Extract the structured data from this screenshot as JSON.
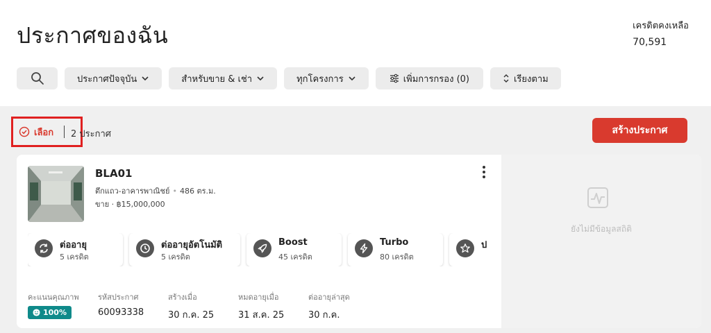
{
  "header": {
    "title": "ประกาศของฉัน",
    "credit_label": "เครดิตคงเหลือ",
    "credit_value": "70,591"
  },
  "filters": [
    {
      "label": "ประกาศปัจจุบัน",
      "icon": "chevron-down-icon"
    },
    {
      "label": "สำหรับขาย & เช่า",
      "icon": "chevron-down-icon"
    },
    {
      "label": "ทุกโครงการ",
      "icon": "chevron-down-icon"
    },
    {
      "label": "เพิ่มการกรอง (0)",
      "icon": "filter-sliders-icon"
    },
    {
      "label": "เรียงตาม",
      "icon": "sort-icon"
    }
  ],
  "toolbar": {
    "select_label": "เลือก",
    "count_text": "2 ประกาศ",
    "create_label": "สร้างประกาศ"
  },
  "listing": {
    "code": "BLA01",
    "property_type": "ตึกแถว-อาคารพาณิชย์",
    "area": "486 ตร.ม.",
    "price_line": "ขาย · ฿15,000,000",
    "boost_options": [
      {
        "title": "ต่ออายุ",
        "sub": "5 เครดิต",
        "icon": "refresh-icon"
      },
      {
        "title": "ต่ออายุอัตโนมัติ",
        "sub": "5 เครดิต",
        "icon": "clock-icon"
      },
      {
        "title": "Boost",
        "sub": "45 เครดิต",
        "icon": "rocket-icon"
      },
      {
        "title": "Turbo",
        "sub": "80 เครดิต",
        "icon": "lightning-icon"
      },
      {
        "title": "ป",
        "sub": "",
        "icon": "star-icon"
      }
    ],
    "meta": {
      "quality_label": "คะแนนคุณภาพ",
      "quality_value": "100%",
      "id_label": "รหัสประกาศ",
      "id_value": "60093338",
      "created_label": "สร้างเมื่อ",
      "created_value": "30 ก.ค. 25",
      "expires_label": "หมดอายุเมื่อ",
      "expires_value": "31 ส.ค. 25",
      "renewed_label": "ต่ออายุล่าสุด",
      "renewed_value": "30 ก.ค."
    },
    "stats_empty_text": "ยังไม่มีข้อมูลสถิติ"
  },
  "colors": {
    "accent": "#d93a2e",
    "highlight_border": "#e02020",
    "quality_badge": "#0f8a8a"
  }
}
